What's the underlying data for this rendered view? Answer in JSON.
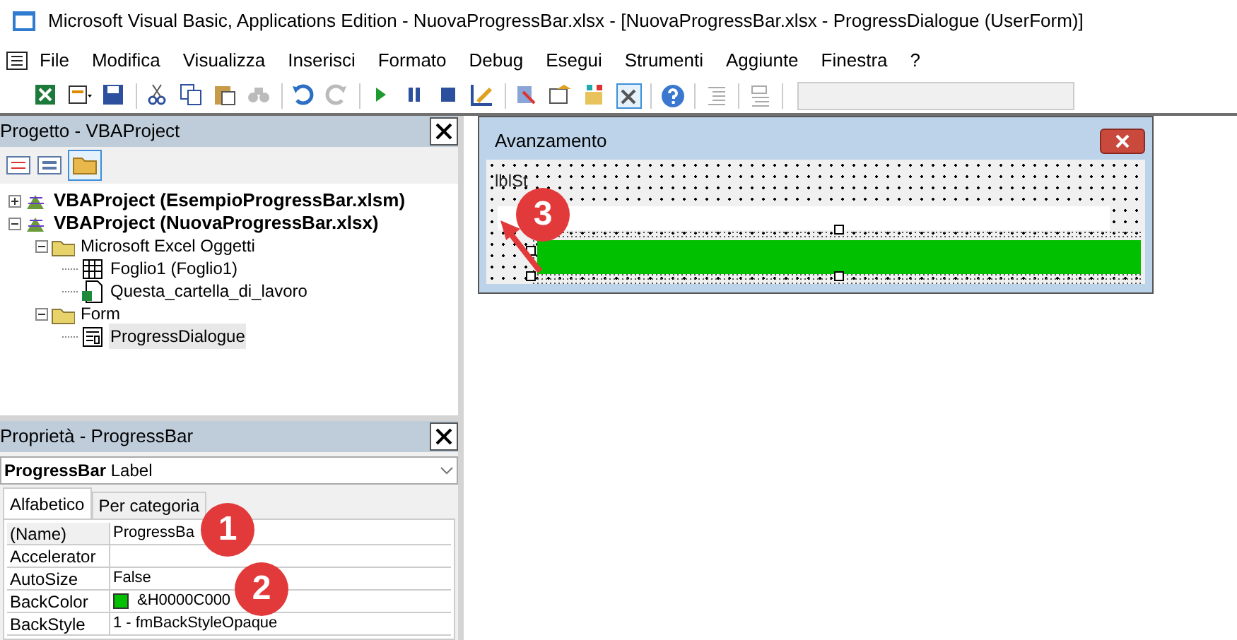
{
  "window": {
    "title": "Microsoft Visual Basic, Applications Edition - NuovaProgressBar.xlsx - [NuovaProgressBar.xlsx - ProgressDialogue (UserForm)]"
  },
  "menu": [
    "File",
    "Modifica",
    "Visualizza",
    "Inserisci",
    "Formato",
    "Debug",
    "Esegui",
    "Strumenti",
    "Aggiunte",
    "Finestra",
    "?"
  ],
  "project_pane": {
    "title": "Progetto - VBAProject",
    "tree": [
      {
        "label": "VBAProject (EsempioProgressBar.xlsm)",
        "kind": "project",
        "expanded": false,
        "selected": false
      },
      {
        "label": "VBAProject (NuovaProgressBar.xlsx)",
        "kind": "project",
        "expanded": true,
        "selected": false,
        "children": [
          {
            "label": "Microsoft Excel Oggetti",
            "kind": "folder",
            "expanded": true,
            "selected": false,
            "children": [
              {
                "label": "Foglio1 (Foglio1)",
                "kind": "sheet",
                "selected": false
              },
              {
                "label": "Questa_cartella_di_lavoro",
                "kind": "workbook",
                "selected": false
              }
            ]
          },
          {
            "label": "Form",
            "kind": "folder",
            "expanded": true,
            "selected": false,
            "children": [
              {
                "label": "ProgressDialogue",
                "kind": "form",
                "selected": true
              }
            ]
          }
        ]
      }
    ]
  },
  "properties_pane": {
    "title": "Proprietà - ProgressBar",
    "object": {
      "name": "ProgressBar",
      "type": "Label"
    },
    "tabs": [
      {
        "label": "Alfabetico",
        "selected": true
      },
      {
        "label": "Per categoria",
        "selected": false
      }
    ],
    "rows": [
      {
        "name": "(Name)",
        "value": "ProgressBa"
      },
      {
        "name": "Accelerator"
      },
      {
        "name": "AutoSize",
        "value": "False"
      },
      {
        "name": "BackColor",
        "value": "&H0000C000",
        "color": "#00c000"
      },
      {
        "name": "BackStyle",
        "value": "1 - fmBackStyleOpaque"
      }
    ]
  },
  "form": {
    "title": "Avanzamento",
    "label": "lblSt",
    "progress_bar": {
      "selected": true
    }
  },
  "callouts": [
    "1",
    "2",
    "3"
  ]
}
